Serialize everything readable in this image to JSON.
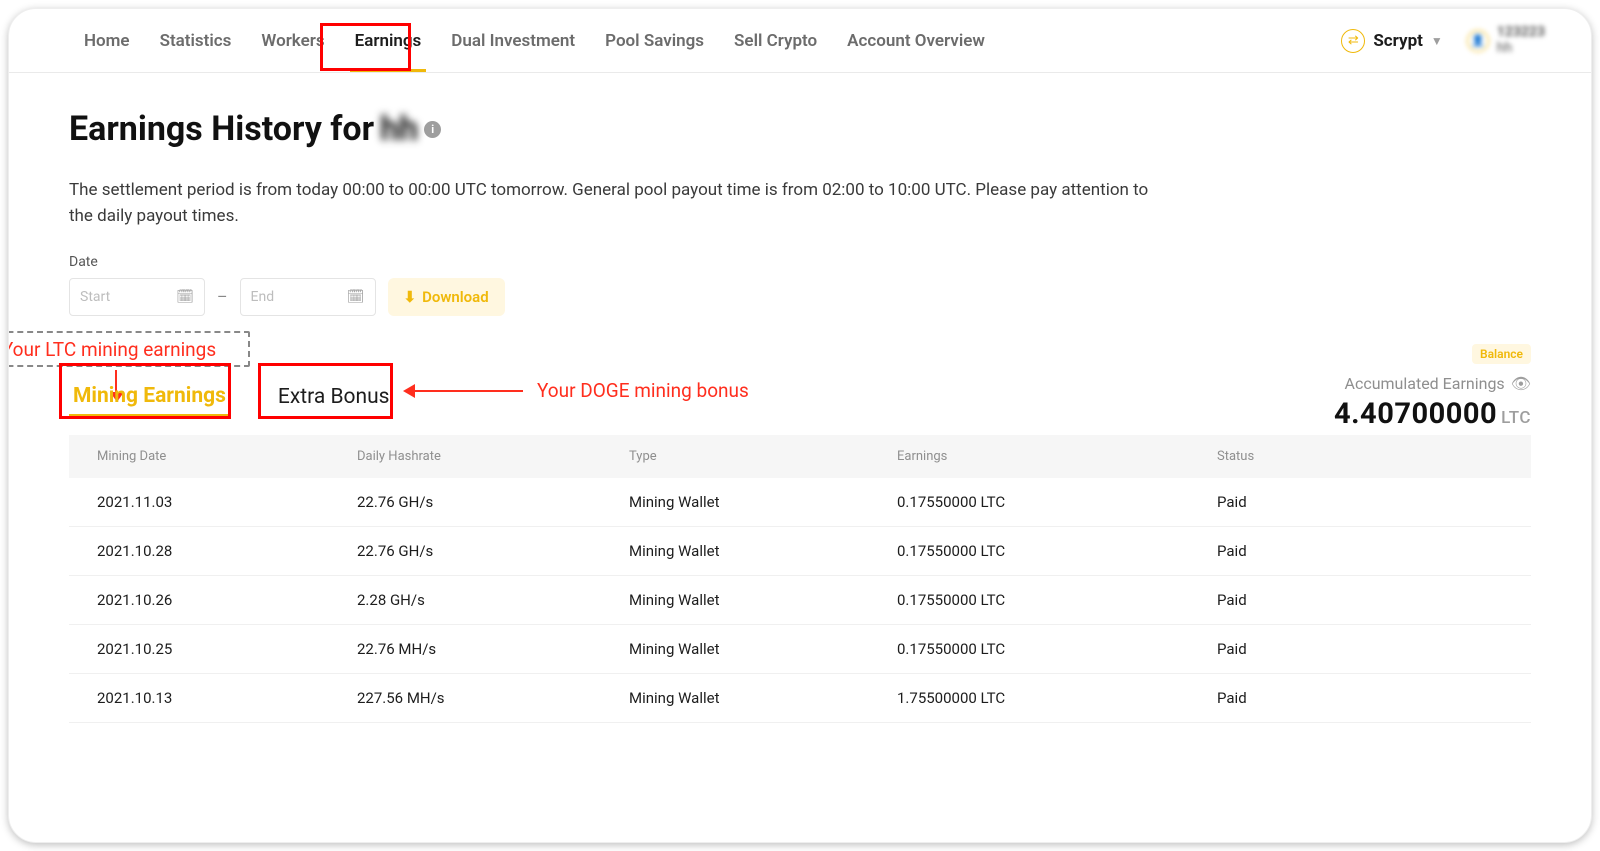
{
  "nav": {
    "items": [
      "Home",
      "Statistics",
      "Workers",
      "Earnings",
      "Dual Investment",
      "Pool Savings",
      "Sell Crypto",
      "Account Overview"
    ],
    "activeIndex": 3
  },
  "scrypt": {
    "label": "Scrypt"
  },
  "user": {
    "line1": "123223",
    "line2": "hh"
  },
  "pageTitle": {
    "prefix": "Earnings History for ",
    "blurred": "hh"
  },
  "desc": "The settlement period is from today 00:00 to 00:00 UTC tomorrow. General pool payout time is from 02:00 to 10:00 UTC. Please pay attention to the daily payout times.",
  "dateSection": {
    "label": "Date",
    "startPlaceholder": "Start",
    "endPlaceholder": "End",
    "downloadLabel": "Download"
  },
  "annotations": {
    "ltc": "Your LTC mining earnings",
    "doge": "Your DOGE mining bonus"
  },
  "tabs": {
    "mining": "Mining Earnings",
    "bonus": "Extra Bonus"
  },
  "summary": {
    "balanceChip": "Balance",
    "accLabel": "Accumulated Earnings",
    "accValue": "4.40700000",
    "accUnit": "LTC"
  },
  "table": {
    "headers": [
      "Mining Date",
      "Daily Hashrate",
      "Type",
      "Earnings",
      "Status"
    ],
    "rows": [
      {
        "date": "2021.11.03",
        "hash": "22.76 GH/s",
        "type": "Mining Wallet",
        "earn": "0.17550000 LTC",
        "status": "Paid"
      },
      {
        "date": "2021.10.28",
        "hash": "22.76 GH/s",
        "type": "Mining Wallet",
        "earn": "0.17550000 LTC",
        "status": "Paid"
      },
      {
        "date": "2021.10.26",
        "hash": "2.28 GH/s",
        "type": "Mining Wallet",
        "earn": "0.17550000 LTC",
        "status": "Paid"
      },
      {
        "date": "2021.10.25",
        "hash": "22.76 MH/s",
        "type": "Mining Wallet",
        "earn": "0.17550000 LTC",
        "status": "Paid"
      },
      {
        "date": "2021.10.13",
        "hash": "227.56 MH/s",
        "type": "Mining Wallet",
        "earn": "1.75500000 LTC",
        "status": "Paid"
      }
    ]
  }
}
